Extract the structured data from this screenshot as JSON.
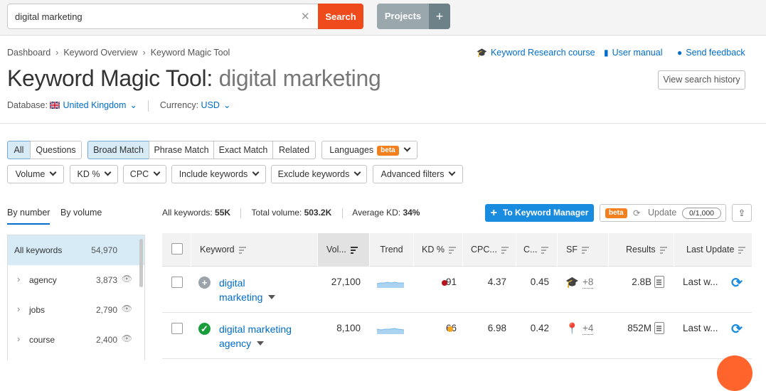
{
  "search": {
    "value": "digital marketing",
    "button": "Search"
  },
  "projects": {
    "label": "Projects",
    "plus": "+"
  },
  "breadcrumb": [
    "Dashboard",
    "Keyword Overview",
    "Keyword Magic Tool"
  ],
  "header_links": {
    "course": "Keyword Research course",
    "manual": "User manual",
    "feedback": "Send feedback"
  },
  "title": {
    "main": "Keyword Magic Tool:",
    "query": "digital marketing"
  },
  "history_button": "View search history",
  "database": {
    "label": "Database:",
    "value": "United Kingdom"
  },
  "currency": {
    "label": "Currency:",
    "value": "USD"
  },
  "filters_row1": {
    "all": "All",
    "questions": "Questions",
    "broad": "Broad Match",
    "phrase": "Phrase Match",
    "exact": "Exact Match",
    "related": "Related",
    "languages": "Languages",
    "beta": "beta"
  },
  "filters_row2": {
    "volume": "Volume",
    "kd": "KD %",
    "cpc": "CPC",
    "include": "Include keywords",
    "exclude": "Exclude keywords",
    "advanced": "Advanced filters"
  },
  "group_tabs": {
    "by_number": "By number",
    "by_volume": "By volume"
  },
  "groups": [
    {
      "name": "All keywords",
      "count": "54,970"
    },
    {
      "name": "agency",
      "count": "3,873"
    },
    {
      "name": "jobs",
      "count": "2,790"
    },
    {
      "name": "course",
      "count": "2,400"
    }
  ],
  "stats": {
    "all_label": "All keywords:",
    "all_value": "55K",
    "volume_label": "Total volume:",
    "volume_value": "503.2K",
    "kd_label": "Average KD:",
    "kd_value": "34%"
  },
  "km_button": "To Keyword Manager",
  "update": {
    "beta": "beta",
    "label": "Update",
    "quota": "0/1,000"
  },
  "table": {
    "headers": {
      "keyword": "Keyword",
      "volume": "Vol...",
      "trend": "Trend",
      "kd": "KD %",
      "cpc": "CPC...",
      "com": "C...",
      "sf": "SF",
      "results": "Results",
      "last_update": "Last Update"
    },
    "rows": [
      {
        "keyword_line1": "digital",
        "keyword_line2": "marketing",
        "volume": "27,100",
        "kd": "91",
        "kd_color": "#b5121b",
        "cpc": "4.37",
        "com": "0.45",
        "sf_more": "+8",
        "results": "2.8B",
        "last_update": "Last w..."
      },
      {
        "keyword_line1": "digital marketing",
        "keyword_line2": "agency",
        "volume": "8,100",
        "kd": "66",
        "kd_color": "#f5a623",
        "cpc": "6.98",
        "com": "0.42",
        "sf_more": "+4",
        "results": "852M",
        "last_update": "Last w..."
      }
    ]
  },
  "colors": {
    "accent": "#006dca",
    "search_button": "#ee4a1b",
    "primary_button": "#1a8cdf",
    "selected_bg": "#d7ebf7"
  }
}
